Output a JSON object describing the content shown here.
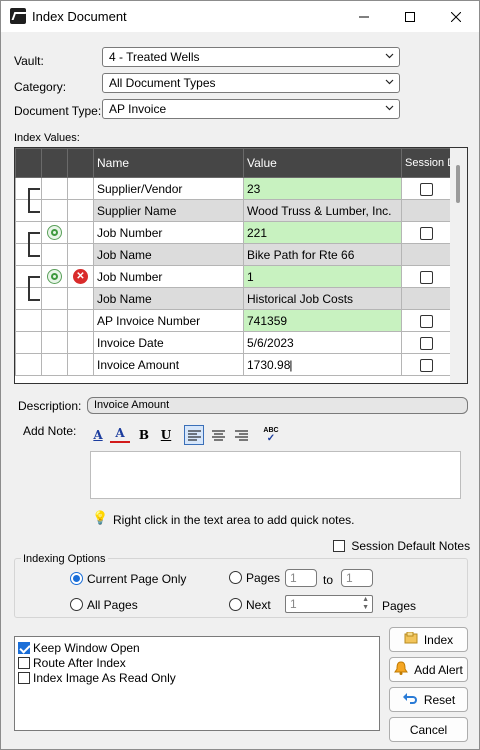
{
  "window": {
    "title": "Index Document",
    "minimize": "—",
    "maximize": "☐",
    "close": "✕"
  },
  "form": {
    "vault_label": "Vault:",
    "vault_value": "4 - Treated Wells",
    "category_label": "Category:",
    "category_value": "All Document Types",
    "doctype_label": "Document Type:",
    "doctype_value": "AP Invoice",
    "index_values_label": "Index Values:"
  },
  "grid": {
    "headers": {
      "name": "Name",
      "value": "Value",
      "session_default": "Session Default"
    },
    "rows": [
      {
        "name": "Supplier/Vendor",
        "value": "23",
        "icon": "",
        "kind": "primary"
      },
      {
        "name": "Supplier Name",
        "value": "Wood Truss & Lumber, Inc.",
        "icon": "",
        "kind": "sub"
      },
      {
        "name": "Job Number",
        "value": "221",
        "icon": "add-icon",
        "kind": "primary"
      },
      {
        "name": "Job Name",
        "value": "Bike Path for Rte 66",
        "icon": "",
        "kind": "sub"
      },
      {
        "name": "Job Number",
        "value": "1",
        "icon": "add-icon|remove-icon",
        "kind": "primary"
      },
      {
        "name": "Job Name",
        "value": "Historical Job Costs",
        "icon": "",
        "kind": "sub"
      },
      {
        "name": "AP Invoice Number",
        "value": "741359",
        "icon": "",
        "kind": "primary"
      },
      {
        "name": "Invoice Date",
        "value": "5/6/2023",
        "icon": "",
        "kind": "plain"
      },
      {
        "name": "Invoice Amount",
        "value": "1730.98",
        "icon": "",
        "kind": "editing"
      }
    ]
  },
  "description": {
    "label": "Description:",
    "value": "Invoice Amount"
  },
  "note": {
    "label": "Add Note:",
    "hint": "Right click in the text area to add quick notes.",
    "session_default_notes": "Session Default Notes"
  },
  "indexing": {
    "group_label": "Indexing Options",
    "current_page": "Current Page Only",
    "all_pages": "All Pages",
    "pages": "Pages",
    "pages_from": "1",
    "to": "to",
    "pages_to": "1",
    "next": "Next",
    "next_value": "1",
    "pages_suffix": "Pages"
  },
  "options": {
    "keep_window_open": "Keep Window Open",
    "route_after_index": "Route After Index",
    "index_read_only": "Index Image As Read Only"
  },
  "buttons": {
    "index": "Index",
    "add_alert": "Add Alert",
    "reset": "Reset",
    "cancel": "Cancel"
  },
  "colors": {
    "value_green": "#c8f2c0",
    "header_dark": "#464646",
    "accent": "#1a6ed8"
  }
}
